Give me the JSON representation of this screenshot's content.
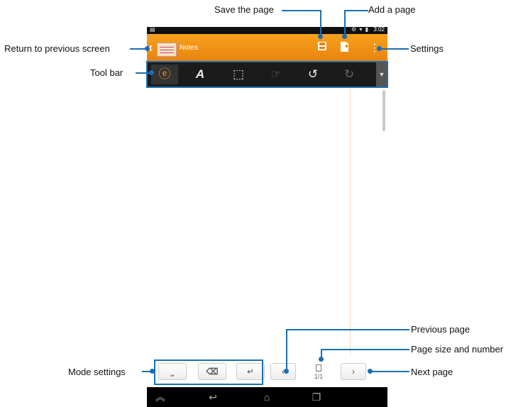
{
  "app": {
    "title": "Notes"
  },
  "status_bar": {
    "time": "3:02",
    "icons": "⚙ ▾ ▮"
  },
  "action_bar": {
    "icons": {
      "back": "chevron-left-icon",
      "save": "save-icon",
      "add_page": "add-page-icon",
      "settings": "overflow-menu-icon"
    }
  },
  "toolbar": {
    "items": [
      {
        "name": "pen",
        "glyph": "ⓔ"
      },
      {
        "name": "font",
        "glyph": "A"
      },
      {
        "name": "insert",
        "glyph": "⬚"
      },
      {
        "name": "selection",
        "glyph": "☞"
      },
      {
        "name": "undo",
        "glyph": "↺"
      },
      {
        "name": "redo",
        "glyph": "↻"
      }
    ]
  },
  "page": {
    "number": "1/1"
  },
  "callouts": {
    "save": "Save the page",
    "add": "Add a page",
    "return": "Return to previous screen",
    "settings": "Settings",
    "toolbar": "Tool bar",
    "previous": "Previous page",
    "page_size": "Page size and number",
    "mode": "Mode settings",
    "next": "Next page"
  },
  "colors": {
    "accent": "#f29a16",
    "callout": "#1a6fb3"
  }
}
